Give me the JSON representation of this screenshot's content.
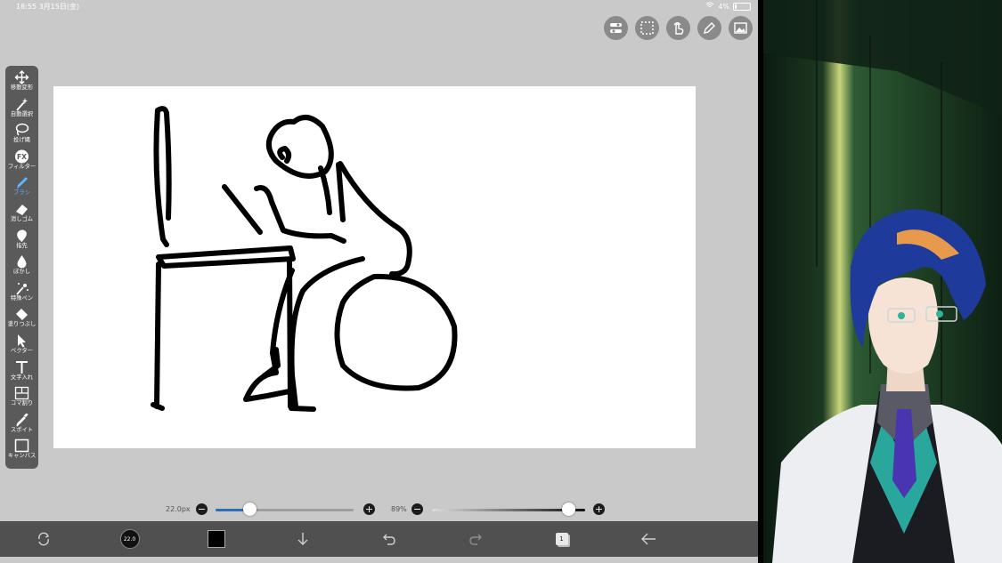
{
  "status_bar": {
    "time": "18:55  3月15日(金)",
    "battery": "4%"
  },
  "top_tools": [
    "layer-toggle-icon",
    "selection-icon",
    "gesture-icon",
    "pen-icon",
    "gallery-icon"
  ],
  "toolbar": {
    "items": [
      {
        "icon": "move-transform-icon",
        "label": "移動変形"
      },
      {
        "icon": "auto-select-icon",
        "label": "自動選択"
      },
      {
        "icon": "lasso-icon",
        "label": "投げ縄"
      },
      {
        "icon": "filter-icon",
        "label": "フィルター"
      },
      {
        "icon": "brush-icon",
        "label": "ブラシ",
        "active": true
      },
      {
        "icon": "eraser-icon",
        "label": "消しゴム"
      },
      {
        "icon": "finger-icon",
        "label": "指先"
      },
      {
        "icon": "blur-icon",
        "label": "ぼかし"
      },
      {
        "icon": "special-pen-icon",
        "label": "特殊ペン"
      },
      {
        "icon": "fill-icon",
        "label": "塗りつぶし"
      },
      {
        "icon": "vector-icon",
        "label": "ベクター"
      },
      {
        "icon": "text-icon",
        "label": "文字入れ"
      },
      {
        "icon": "frame-divide-icon",
        "label": "コマ割り"
      },
      {
        "icon": "eyedropper-icon",
        "label": "スポイト"
      },
      {
        "icon": "canvas-icon",
        "label": "キャンバス"
      }
    ]
  },
  "sliders": {
    "brush_size": {
      "label": "22.0px",
      "minus": "−",
      "plus": "+",
      "value_fraction": 0.25
    },
    "opacity": {
      "label": "89%",
      "minus": "−",
      "plus": "+",
      "value_fraction": 0.89
    }
  },
  "bottom_bar": {
    "brush_preview_label": "22.0",
    "layer_count": "1",
    "items": [
      "quick-action-icon",
      "brush-size-icon",
      "color-swatch",
      "download-icon",
      "undo-icon",
      "redo-icon",
      "layers-icon",
      "back-icon"
    ]
  },
  "colors": {
    "accent": "#5fb6ff",
    "stroke": "#000000",
    "toolbar_bg": "#5a5a5a"
  }
}
